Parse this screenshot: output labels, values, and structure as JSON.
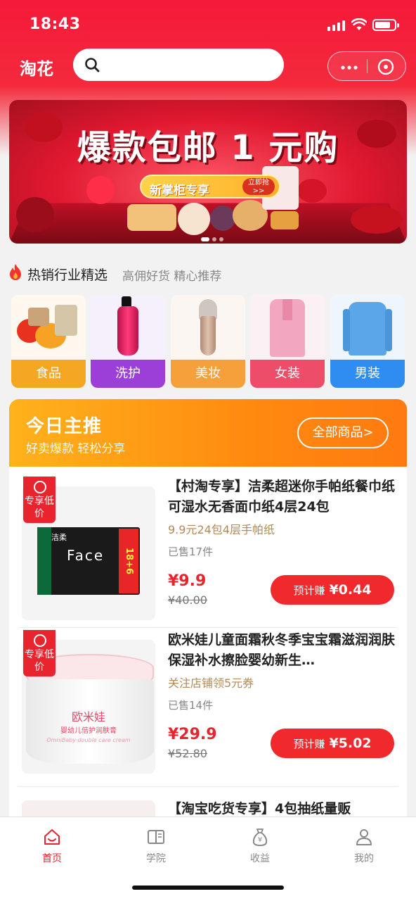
{
  "status_bar": {
    "time": "18:43"
  },
  "header": {
    "brand": "淘花",
    "search_placeholder": ""
  },
  "banner": {
    "title": "爆款包邮 1 元购",
    "pill_text": "新掌柜专享",
    "pill_button": "立即抢 >>"
  },
  "hot_section": {
    "title": "热销行业精选",
    "subtitle": "高佣好货 精心推荐"
  },
  "categories": [
    {
      "label": "食品",
      "color": "#f5a623"
    },
    {
      "label": "洗护",
      "color": "#9c3fd8"
    },
    {
      "label": "美妆",
      "color": "#f5a03b"
    },
    {
      "label": "女装",
      "color": "#ee4d6a"
    },
    {
      "label": "男装",
      "color": "#2f8cf0"
    }
  ],
  "today": {
    "title": "今日主推",
    "subtitle": "好卖爆款 轻松分享",
    "all_button": "全部商品>"
  },
  "products": [
    {
      "tag": "专享低价",
      "title": "【村淘专享】洁柔超迷你手帕纸餐巾纸可湿水无香面巾纸4层24包",
      "desc": "9.9元24包4层手帕纸",
      "sold": "已售17件",
      "price": "¥9.9",
      "old_price": "¥40.00",
      "earn_label": "预计赚",
      "earn_amount": "¥0.44",
      "thumb_brand": "洁柔",
      "thumb_text": "Face",
      "thumb_badge": "18+6"
    },
    {
      "tag": "专享低价",
      "title": "欧米娃儿童面霜秋冬季宝宝霜滋润润肤保湿补水擦脸婴幼新生…",
      "desc": "关注店铺领5元券",
      "sold": "已售14件",
      "price": "¥29.9",
      "old_price": "¥52.80",
      "earn_label": "预计赚",
      "earn_amount": "¥5.02",
      "thumb_brand": "欧米娃",
      "thumb_text": "婴幼儿倍护润肤膏",
      "thumb_badge": "OmniBaby·double care cream"
    },
    {
      "title": "【淘宝吃货专享】4包抽纸量贩"
    }
  ],
  "tabbar": [
    {
      "label": "首页",
      "icon": "home-icon",
      "active": true
    },
    {
      "label": "学院",
      "icon": "book-icon",
      "active": false
    },
    {
      "label": "收益",
      "icon": "money-bag-icon",
      "active": false
    },
    {
      "label": "我的",
      "icon": "user-icon",
      "active": false
    }
  ],
  "colors": {
    "primary_red": "#f5193a",
    "price_red": "#e8242e",
    "orange": "#ff8a10"
  }
}
